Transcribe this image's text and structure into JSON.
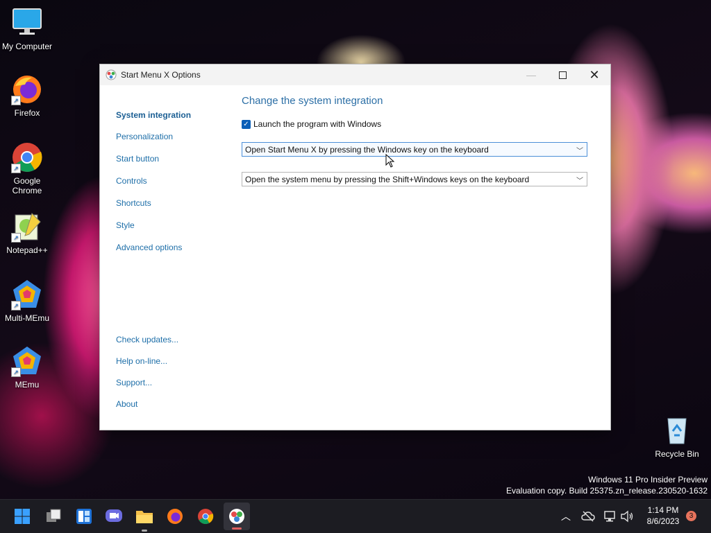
{
  "desktop": {
    "icons": [
      {
        "label": "My Computer"
      },
      {
        "label": "Firefox"
      },
      {
        "label": "Google Chrome"
      },
      {
        "label": "Notepad++"
      },
      {
        "label": "Multi-MEmu"
      },
      {
        "label": "MEmu"
      },
      {
        "label": "Recycle Bin"
      }
    ],
    "watermark_line1": "Windows 11 Pro Insider Preview",
    "watermark_line2": "Evaluation copy. Build 25375.zn_release.230520-1632"
  },
  "window": {
    "title": "Start Menu X Options",
    "nav_items": [
      {
        "label": "System integration",
        "active": true
      },
      {
        "label": "Personalization"
      },
      {
        "label": "Start button"
      },
      {
        "label": "Controls"
      },
      {
        "label": "Shortcuts"
      },
      {
        "label": "Style"
      },
      {
        "label": "Advanced options"
      }
    ],
    "nav_links": [
      {
        "label": "Check updates..."
      },
      {
        "label": "Help on-line..."
      },
      {
        "label": "Support..."
      },
      {
        "label": "About"
      }
    ],
    "heading": "Change the system integration",
    "launch_checkbox": {
      "label": "Launch the program with Windows",
      "checked": true
    },
    "windows_key_select": {
      "value": "Open Start Menu X by pressing the Windows key on the keyboard"
    },
    "shift_windows_select": {
      "value": "Open the system menu by pressing the Shift+Windows keys on the keyboard"
    }
  },
  "taskbar": {
    "clock_time": "1:14 PM",
    "clock_date": "8/6/2023",
    "notification_count": "3"
  },
  "colors": {
    "accent": "#0a5fb8",
    "link": "#1d6ea8",
    "taskbar": "#1c1c22"
  }
}
